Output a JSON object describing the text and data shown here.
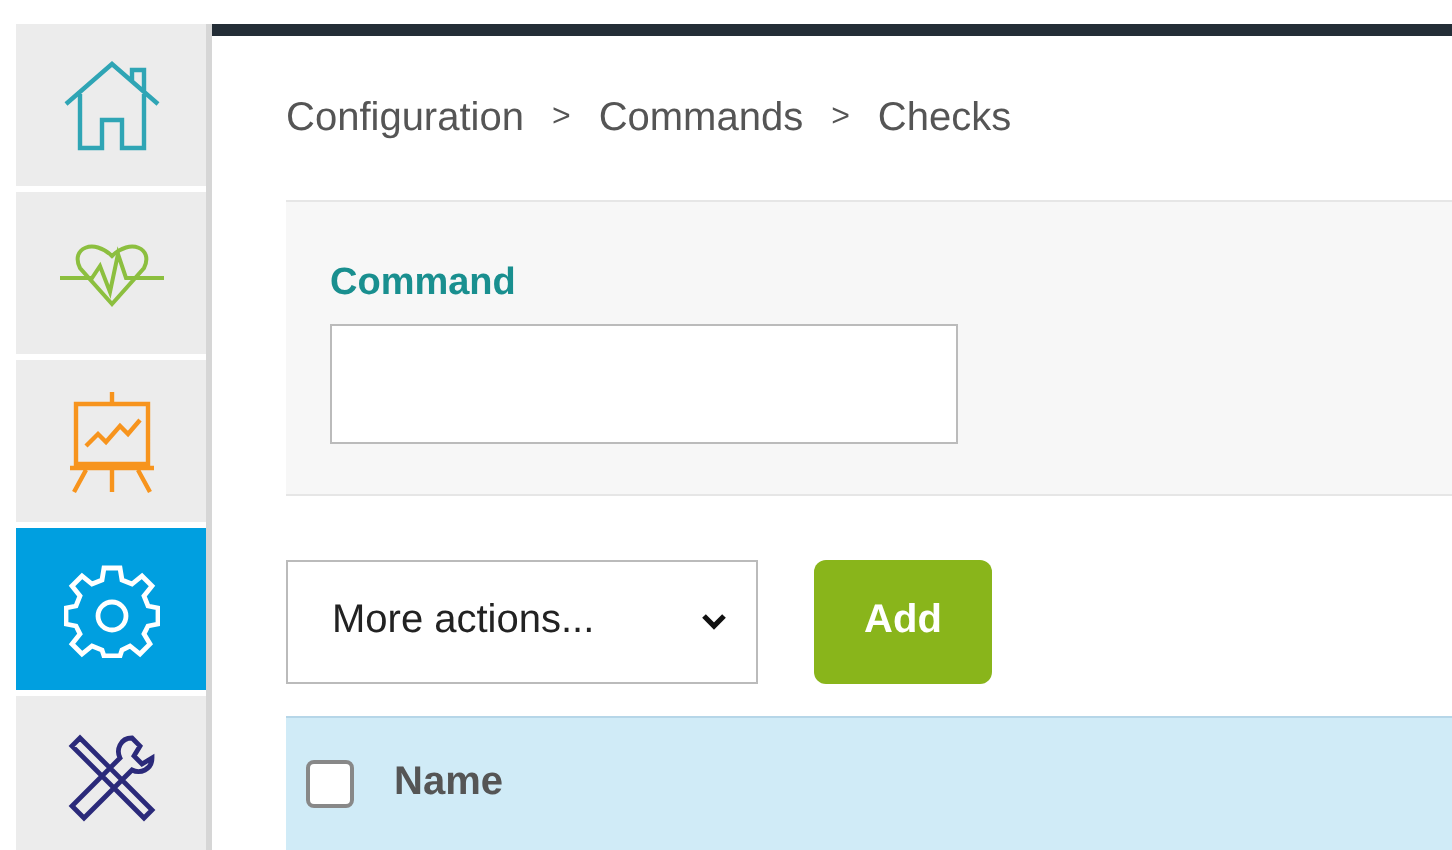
{
  "sidebar": {
    "items": [
      {
        "kind": "home",
        "selected": false
      },
      {
        "kind": "health",
        "selected": false
      },
      {
        "kind": "chart",
        "selected": false
      },
      {
        "kind": "settings",
        "selected": true
      },
      {
        "kind": "tools",
        "selected": false
      }
    ]
  },
  "breadcrumb": [
    {
      "kind": "link",
      "text": "Configuration"
    },
    {
      "kind": "separator",
      "text": ">"
    },
    {
      "kind": "link",
      "text": "Commands"
    },
    {
      "kind": "separator",
      "text": ">"
    },
    {
      "kind": "current",
      "text": "Checks"
    }
  ],
  "filter": {
    "label": "Command"
  },
  "actions": {
    "select": "More actions...",
    "add_button": "Add"
  },
  "table": {
    "select_all_checked": false,
    "columns": [
      "Name"
    ]
  }
}
